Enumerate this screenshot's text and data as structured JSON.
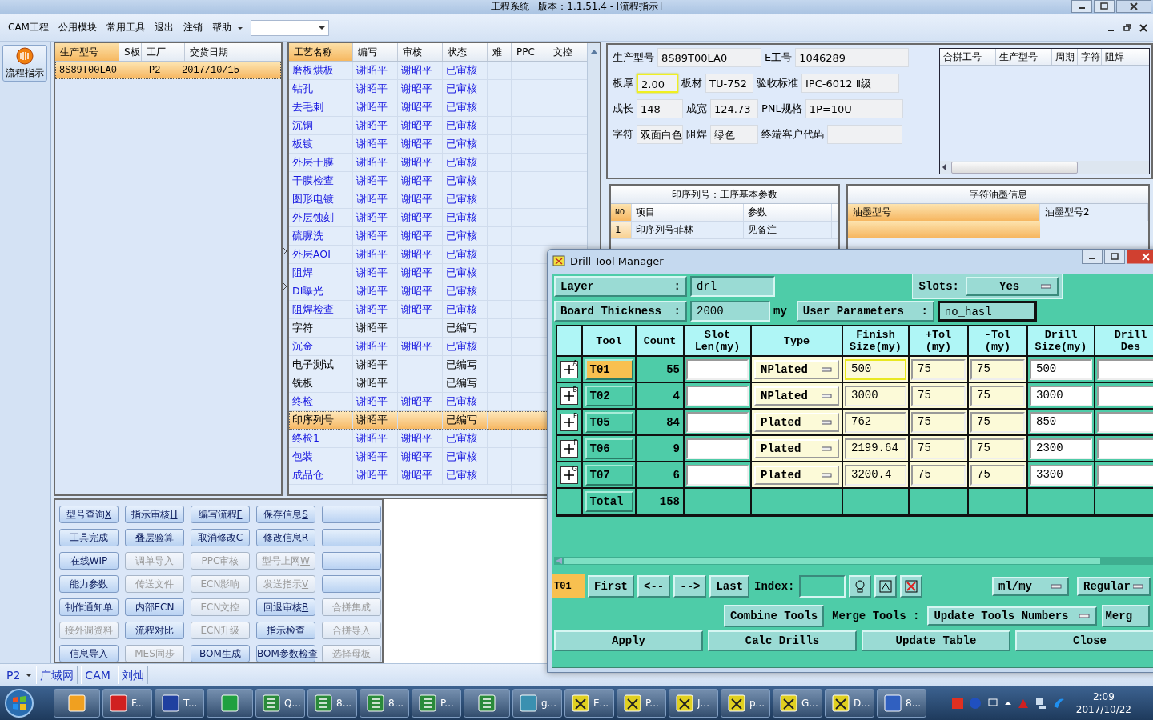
{
  "window": {
    "title": "工程系统   版本：1.1.51.4 - [流程指示]"
  },
  "menu": {
    "items": [
      "CAM工程",
      "公用模块",
      "常用工具",
      "退出",
      "注销",
      "帮助"
    ]
  },
  "sidebar": {
    "button": "流程指示"
  },
  "product_table": {
    "columns": [
      {
        "label": "生产型号",
        "selected": true
      },
      {
        "label": "S板",
        "selected": false
      },
      {
        "label": "工厂",
        "selected": false
      },
      {
        "label": "交货日期",
        "selected": false
      }
    ],
    "rows": [
      {
        "model": "8S89T00LA0",
        "factory": "P2",
        "delivery": "2017/10/15",
        "selected": true
      }
    ]
  },
  "process_table": {
    "columns": [
      {
        "label": "工艺名称",
        "selected": true
      },
      {
        "label": "编写",
        "selected": false
      },
      {
        "label": "审核",
        "selected": false
      },
      {
        "label": "状态",
        "selected": false
      },
      {
        "label": "难",
        "selected": false
      },
      {
        "label": "PPC",
        "selected": false
      },
      {
        "label": "文控",
        "selected": false
      }
    ],
    "rows": [
      {
        "name": "磨板烘板",
        "writer": "谢昭平",
        "reviewer": "谢昭平",
        "status": "已审核",
        "approved": true,
        "selected": false
      },
      {
        "name": "钻孔",
        "writer": "谢昭平",
        "reviewer": "谢昭平",
        "status": "已审核",
        "approved": true,
        "selected": false
      },
      {
        "name": "去毛刺",
        "writer": "谢昭平",
        "reviewer": "谢昭平",
        "status": "已审核",
        "approved": true,
        "selected": false
      },
      {
        "name": "沉铜",
        "writer": "谢昭平",
        "reviewer": "谢昭平",
        "status": "已审核",
        "approved": true,
        "selected": false
      },
      {
        "name": "板镀",
        "writer": "谢昭平",
        "reviewer": "谢昭平",
        "status": "已审核",
        "approved": true,
        "selected": false
      },
      {
        "name": "外层干膜",
        "writer": "谢昭平",
        "reviewer": "谢昭平",
        "status": "已审核",
        "approved": true,
        "selected": false
      },
      {
        "name": "干膜检查",
        "writer": "谢昭平",
        "reviewer": "谢昭平",
        "status": "已审核",
        "approved": true,
        "selected": false
      },
      {
        "name": "图形电镀",
        "writer": "谢昭平",
        "reviewer": "谢昭平",
        "status": "已审核",
        "approved": true,
        "selected": false
      },
      {
        "name": "外层蚀刻",
        "writer": "谢昭平",
        "reviewer": "谢昭平",
        "status": "已审核",
        "approved": true,
        "selected": false
      },
      {
        "name": "硫脲洗",
        "writer": "谢昭平",
        "reviewer": "谢昭平",
        "status": "已审核",
        "approved": true,
        "selected": false
      },
      {
        "name": "外层AOI",
        "writer": "谢昭平",
        "reviewer": "谢昭平",
        "status": "已审核",
        "approved": true,
        "selected": false
      },
      {
        "name": "阻焊",
        "writer": "谢昭平",
        "reviewer": "谢昭平",
        "status": "已审核",
        "approved": true,
        "selected": false
      },
      {
        "name": "DI曝光",
        "writer": "谢昭平",
        "reviewer": "谢昭平",
        "status": "已审核",
        "approved": true,
        "selected": false
      },
      {
        "name": "阻焊检查",
        "writer": "谢昭平",
        "reviewer": "谢昭平",
        "status": "已审核",
        "approved": true,
        "selected": false
      },
      {
        "name": "字符",
        "writer": "谢昭平",
        "status": "已编写",
        "approved": false,
        "selected": false
      },
      {
        "name": "沉金",
        "writer": "谢昭平",
        "reviewer": "谢昭平",
        "status": "已审核",
        "approved": true,
        "selected": false
      },
      {
        "name": "电子测试",
        "writer": "谢昭平",
        "status": "已编写",
        "approved": false,
        "selected": false
      },
      {
        "name": "铣板",
        "writer": "谢昭平",
        "status": "已编写",
        "approved": false,
        "selected": false
      },
      {
        "name": "终检",
        "writer": "谢昭平",
        "reviewer": "谢昭平",
        "status": "已审核",
        "approved": true,
        "selected": false
      },
      {
        "name": "印序列号",
        "writer": "谢昭平",
        "status": "已编写",
        "approved": false,
        "selected": true
      },
      {
        "name": "终检1",
        "writer": "谢昭平",
        "reviewer": "谢昭平",
        "status": "已审核",
        "approved": true,
        "selected": false
      },
      {
        "name": "包装",
        "writer": "谢昭平",
        "reviewer": "谢昭平",
        "status": "已审核",
        "approved": true,
        "selected": false
      },
      {
        "name": "成品仓",
        "writer": "谢昭平",
        "reviewer": "谢昭平",
        "status": "已审核",
        "approved": true,
        "selected": false
      }
    ]
  },
  "actions": [
    {
      "label": "型号查询",
      "key": "X",
      "disabled": false
    },
    {
      "label": "指示审核",
      "key": "H",
      "disabled": false
    },
    {
      "label": "编写流程",
      "key": "F",
      "disabled": false
    },
    {
      "label": "保存信息",
      "key": "S",
      "disabled": false
    },
    {
      "disabled": false
    },
    {
      "label": "工具完成",
      "disabled": false
    },
    {
      "label": "叠层验算",
      "disabled": false
    },
    {
      "label": "取消修改",
      "key": "C",
      "disabled": false
    },
    {
      "label": "修改信息",
      "key": "R",
      "disabled": false
    },
    {
      "disabled": false
    },
    {
      "label": "在线WIP",
      "disabled": false
    },
    {
      "label": "调单导入",
      "disabled": true
    },
    {
      "label": "PPC审核",
      "disabled": true
    },
    {
      "label": "型号上网",
      "key": "W",
      "disabled": true
    },
    {
      "disabled": false
    },
    {
      "label": "能力参数",
      "disabled": false
    },
    {
      "label": "传送文件",
      "disabled": true
    },
    {
      "label": "ECN影响",
      "disabled": true
    },
    {
      "label": "发送指示",
      "key": "V",
      "disabled": true
    },
    {
      "disabled": false
    },
    {
      "label": "制作通知单",
      "disabled": false
    },
    {
      "label": "内部ECN",
      "disabled": false
    },
    {
      "label": "ECN文控",
      "disabled": true
    },
    {
      "label": "回退审核",
      "key": "B",
      "disabled": false
    },
    {
      "label": "合拼集成",
      "disabled": true
    },
    {
      "label": "接外调资料",
      "disabled": true
    },
    {
      "label": "流程对比",
      "disabled": false
    },
    {
      "label": "ECN升级",
      "disabled": true
    },
    {
      "label": "指示检查",
      "disabled": false
    },
    {
      "label": "合拼导入",
      "disabled": true
    },
    {
      "label": "信息导入",
      "disabled": false
    },
    {
      "label": "MES同步",
      "disabled": true
    },
    {
      "label": "BOM生成",
      "disabled": false
    },
    {
      "label": "BOM参数检查",
      "disabled": false
    },
    {
      "label": "选择母板",
      "disabled": true
    }
  ],
  "info": {
    "fields": [
      {
        "label": "生产型号",
        "value": "8S89T00LA0",
        "focused": false
      },
      {
        "label": "E工号",
        "value": "1046289",
        "focused": false
      },
      {
        "label": "板厚",
        "value": "2.00",
        "focused": true
      },
      {
        "label": "板材",
        "value": "TU-752",
        "focused": false
      },
      {
        "label": "验收标准",
        "value": "IPC-6012 Ⅱ级",
        "focused": false
      },
      {
        "label": "成长",
        "value": "148",
        "focused": false
      },
      {
        "label": "成宽",
        "value": "124.73",
        "focused": false
      },
      {
        "label": "PNL规格",
        "value": "1P=10U",
        "focused": false
      },
      {
        "label": "字符",
        "value": "双面白色",
        "focused": false
      },
      {
        "label": "阻焊",
        "value": "绿色",
        "focused": false
      },
      {
        "label": "终端客户代码",
        "focused": false
      }
    ]
  },
  "merge_table": {
    "columns": [
      "合拼工号",
      "生产型号",
      "周期",
      "字符",
      "阻焊"
    ]
  },
  "process_params": {
    "title": "印序列号：工序基本参数",
    "columns": [
      "NO",
      "项目",
      "参数"
    ],
    "rows": [
      {
        "no": "1",
        "item": "印序列号菲林",
        "value": "见备注"
      }
    ]
  },
  "ink_info": {
    "title": "字符油墨信息",
    "columns": [
      {
        "label": "油墨型号",
        "selected": true
      },
      {
        "label": "油墨型号2",
        "selected": false
      }
    ]
  },
  "status_bar": {
    "factory": "P2",
    "items": [
      "广域网",
      "CAM",
      "刘灿"
    ]
  },
  "dialog": {
    "title": "Drill Tool Manager",
    "layer_label": [
      "Layer",
      ":"
    ],
    "layer": "drl",
    "slots_label": "Slots:",
    "slots": "Yes",
    "thickness_label": [
      "Board Thickness",
      ":"
    ],
    "thickness": "2000",
    "thickness_unit": "my",
    "params_label": [
      "User Parameters",
      ":"
    ],
    "params": "no_hasl",
    "columns": [
      "Tool",
      "Count",
      "Slot\nLen(my)",
      "Type",
      "Finish\nSize(my)",
      "+Tol\n(my)",
      "-Tol\n(my)",
      "Drill\nSize(my)",
      "Drill\nDes"
    ],
    "rows": [
      {
        "mark": "A",
        "tool": "T01",
        "count": "55",
        "type": "NPlated",
        "finish": "500",
        "plus_tol": "75",
        "minus_tol": "75",
        "drill_size": "500",
        "selected": true
      },
      {
        "mark": "B",
        "tool": "T02",
        "count": "4",
        "type": "NPlated",
        "finish": "3000",
        "plus_tol": "75",
        "minus_tol": "75",
        "drill_size": "3000",
        "selected": false
      },
      {
        "mark": "E",
        "tool": "T05",
        "count": "84",
        "type": "Plated",
        "finish": "762",
        "plus_tol": "75",
        "minus_tol": "75",
        "drill_size": "850",
        "selected": false
      },
      {
        "mark": "F",
        "tool": "T06",
        "count": "9",
        "type": "Plated",
        "finish": "2199.64",
        "plus_tol": "75",
        "minus_tol": "75",
        "drill_size": "2300",
        "selected": false
      },
      {
        "mark": "G",
        "tool": "T07",
        "count": "6",
        "type": "Plated",
        "finish": "3200.4",
        "plus_tol": "75",
        "minus_tol": "75",
        "drill_size": "3300",
        "selected": false
      }
    ],
    "total": {
      "label": "Total",
      "count": "158"
    },
    "current": "T01",
    "nav": [
      "First",
      "<--",
      "-->",
      "Last"
    ],
    "index_label": "Index:",
    "units": "ml/my",
    "mode": "Regular",
    "tools": {
      "combine": "Combine Tools",
      "merge_label": "Merge Tools :",
      "merge_mode": "Update Tools Numbers",
      "merge_cut": "Merg"
    },
    "buttons": [
      "Apply",
      "Calc Drills",
      "Update Table",
      "Close"
    ]
  },
  "taskbar": {
    "items": [
      {
        "kind": "shell"
      },
      {
        "kind": "red",
        "label": "F..."
      },
      {
        "kind": "disk",
        "label": "T..."
      },
      {
        "kind": "green"
      },
      {
        "kind": "sheet",
        "label": "Q..."
      },
      {
        "kind": "sheet",
        "label": "8..."
      },
      {
        "kind": "sheet",
        "label": "8..."
      },
      {
        "kind": "sheet",
        "label": "P..."
      },
      {
        "kind": "sheet"
      },
      {
        "kind": "disc",
        "label": "g..."
      },
      {
        "kind": "xwin",
        "label": "E..."
      },
      {
        "kind": "xwin",
        "label": "P..."
      },
      {
        "kind": "xwin",
        "label": "J..."
      },
      {
        "kind": "xwin",
        "label": "p..."
      },
      {
        "kind": "xwin",
        "label": "G..."
      },
      {
        "kind": "xwin",
        "label": "D..."
      },
      {
        "kind": "doc",
        "label": "8..."
      }
    ],
    "time": "2:09",
    "date": "2017/10/22"
  }
}
